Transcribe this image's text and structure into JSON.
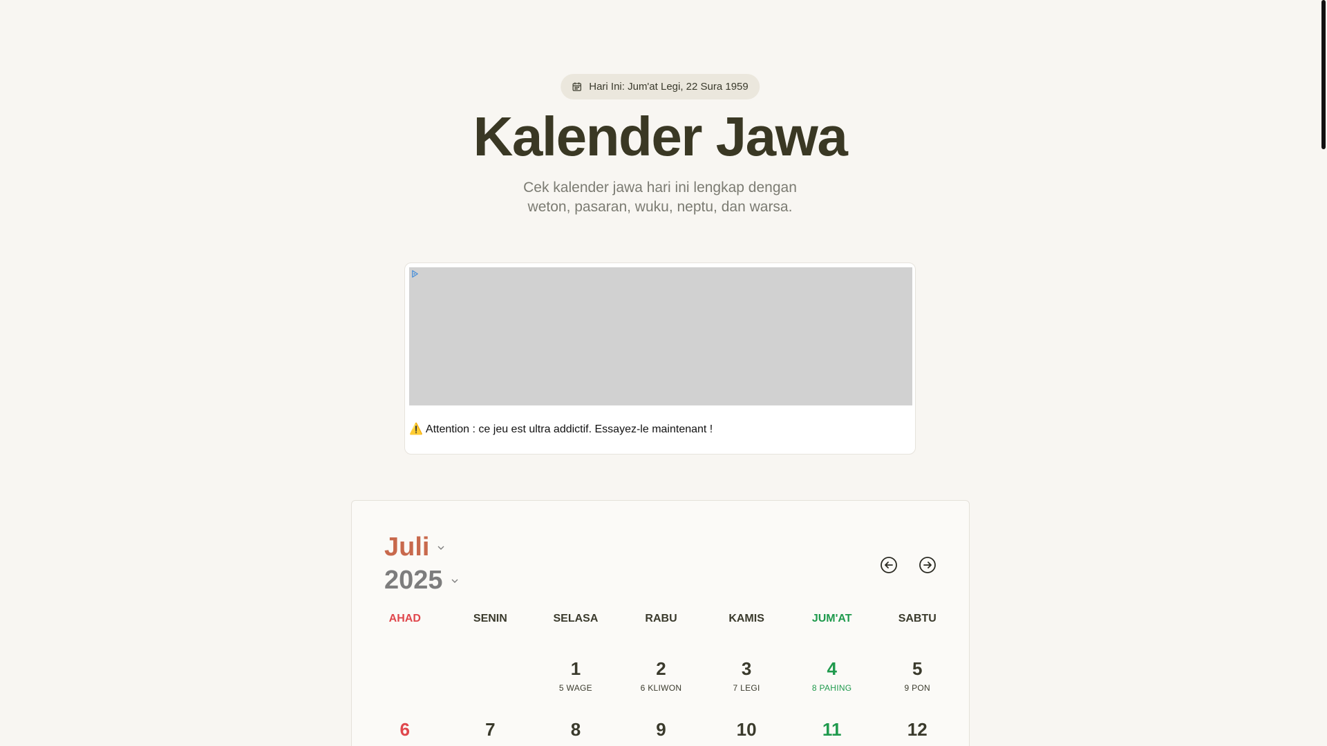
{
  "header": {
    "today_badge": "Hari Ini: Jum'at Legi, 22 Sura 1959",
    "title": "Kalender Jawa",
    "subtitle": "Cek kalender jawa hari ini lengkap dengan weton, pasaran, wuku, neptu, dan warsa."
  },
  "ad": {
    "text": "Attention : ce jeu est ultra addictif. Essayez-le maintenant !",
    "warning_icon": "⚠️"
  },
  "calendar": {
    "month": "Juli",
    "year": "2025",
    "weekdays": [
      "AHAD",
      "SENIN",
      "SELASA",
      "RABU",
      "KAMIS",
      "JUM'AT",
      "SABTU"
    ],
    "week1": [
      {
        "day": "",
        "pasaran": ""
      },
      {
        "day": "",
        "pasaran": ""
      },
      {
        "day": "1",
        "pasaran": "5 WAGE"
      },
      {
        "day": "2",
        "pasaran": "6 KLIWON"
      },
      {
        "day": "3",
        "pasaran": "7 LEGI"
      },
      {
        "day": "4",
        "pasaran": "8 PAHING"
      },
      {
        "day": "5",
        "pasaran": "9 PON"
      }
    ],
    "week2": [
      {
        "day": "6",
        "pasaran": ""
      },
      {
        "day": "7",
        "pasaran": ""
      },
      {
        "day": "8",
        "pasaran": ""
      },
      {
        "day": "9",
        "pasaran": ""
      },
      {
        "day": "10",
        "pasaran": ""
      },
      {
        "day": "11",
        "pasaran": ""
      },
      {
        "day": "12",
        "pasaran": ""
      }
    ]
  },
  "colors": {
    "accent_month": "#c8694c",
    "sunday": "#e0474c",
    "friday": "#1f9a4d",
    "background": "#f8f6f2"
  },
  "icons": {
    "badge": "calendar-icon",
    "prev": "arrow-left-circle-icon",
    "next": "arrow-right-circle-icon",
    "dropdown": "chevron-down-icon",
    "ad": "ad-choices-icon"
  }
}
